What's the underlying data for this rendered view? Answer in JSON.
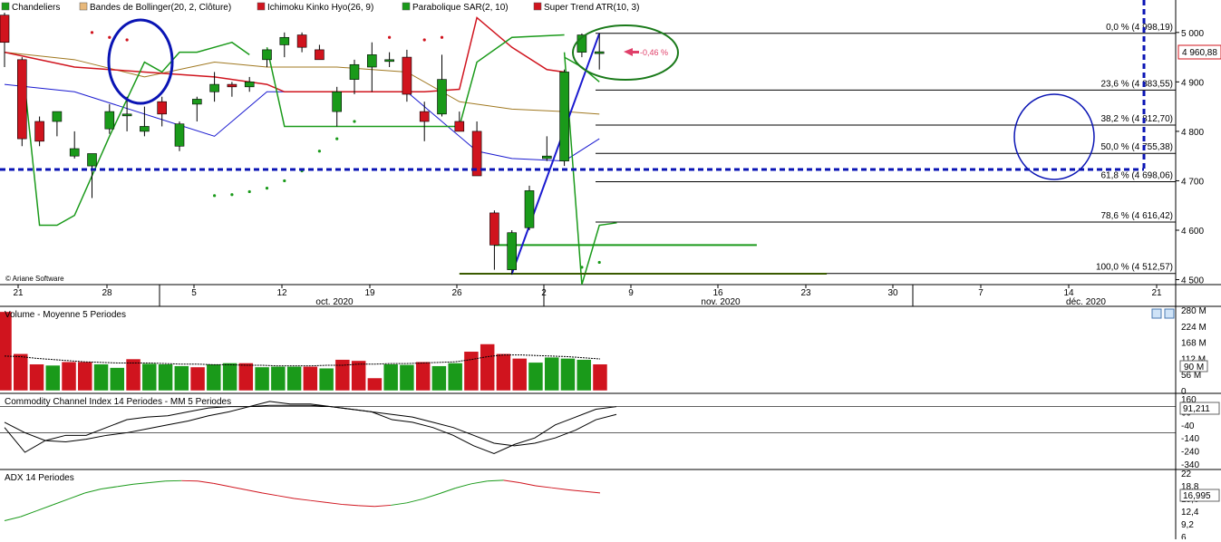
{
  "legend": [
    {
      "label": "Chandeliers",
      "color": "#1a9a1a"
    },
    {
      "label": "Bandes de Bollinger(20, 2, Clôture)",
      "color": "#e8b87a"
    },
    {
      "label": "Ichimoku Kinko Hyo(26, 9)",
      "color": "#d0141e"
    },
    {
      "label": "Parabolique SAR(2, 10)",
      "color": "#1a9a1a"
    },
    {
      "label": "Super Trend ATR(10, 3)",
      "color": "#d0141e"
    }
  ],
  "copyright": "© Ariane Software",
  "badges": {
    "price": "4 960,88",
    "change": "-0,46 %",
    "volume": "90 M",
    "cci": "91,211",
    "adx": "16,995"
  },
  "panels": {
    "volume": "Volume - Moyenne 5 Periodes",
    "cci": "Commodity Channel Index 14 Periodes - MM 5 Periodes",
    "adx": "ADX 14 Periodes"
  },
  "colors": {
    "up": "#1a9a1a",
    "down": "#d0141e",
    "kumo_bear": "#e8b4c8",
    "kumo_bull": "#b8dcb8",
    "bollinger_fill": "#fdf5e6",
    "zone": "#e6e6fa"
  },
  "chart_data": [
    {
      "type": "candlestick",
      "title": "",
      "x_ticks": [
        "21",
        "28",
        "5",
        "12",
        "19",
        "26",
        "2",
        "9",
        "16",
        "23",
        "30",
        "7",
        "14",
        "21"
      ],
      "month_labels": [
        "oct. 2020",
        "nov. 2020",
        "déc. 2020"
      ],
      "ylim": [
        4490,
        5040
      ],
      "y_ticks": [
        "5 000",
        "4 900",
        "4 800",
        "4 700",
        "4 600",
        "4 500"
      ],
      "fibonacci": [
        {
          "label": "0,0 % (4 998,19)",
          "value": 4998.19
        },
        {
          "label": "23,6 % (4 883,55)",
          "value": 4883.55
        },
        {
          "label": "38,2 % (4 812,70)",
          "value": 4812.7
        },
        {
          "label": "50,0 % (4 755,38)",
          "value": 4755.38
        },
        {
          "label": "61,8 % (4 698,06)",
          "value": 4698.06
        },
        {
          "label": "78,6 % (4 616,42)",
          "value": 4616.42
        },
        {
          "label": "100,0 % (4 512,57)",
          "value": 4512.57
        }
      ],
      "last_price": 4960.88,
      "change_pct": -0.46,
      "candles": [
        {
          "o": 5035,
          "h": 5040,
          "l": 4930,
          "c": 4980
        },
        {
          "o": 4945,
          "h": 4950,
          "l": 4770,
          "c": 4785
        },
        {
          "o": 4820,
          "h": 4830,
          "l": 4770,
          "c": 4780
        },
        {
          "o": 4820,
          "h": 4840,
          "l": 4790,
          "c": 4840
        },
        {
          "o": 4750,
          "h": 4800,
          "l": 4745,
          "c": 4765
        },
        {
          "o": 4730,
          "h": 4750,
          "l": 4665,
          "c": 4755
        },
        {
          "o": 4805,
          "h": 4855,
          "l": 4795,
          "c": 4840
        },
        {
          "o": 4835,
          "h": 4870,
          "l": 4800,
          "c": 4835
        },
        {
          "o": 4800,
          "h": 4850,
          "l": 4790,
          "c": 4810
        },
        {
          "o": 4860,
          "h": 4870,
          "l": 4810,
          "c": 4835
        },
        {
          "o": 4770,
          "h": 4820,
          "l": 4760,
          "c": 4815
        },
        {
          "o": 4855,
          "h": 4870,
          "l": 4820,
          "c": 4865
        },
        {
          "o": 4880,
          "h": 4920,
          "l": 4860,
          "c": 4895
        },
        {
          "o": 4895,
          "h": 4900,
          "l": 4870,
          "c": 4890
        },
        {
          "o": 4890,
          "h": 4910,
          "l": 4880,
          "c": 4900
        },
        {
          "o": 4945,
          "h": 4965,
          "l": 4930,
          "c": 4965
        },
        {
          "o": 4975,
          "h": 5000,
          "l": 4950,
          "c": 4990
        },
        {
          "o": 4995,
          "h": 5000,
          "l": 4960,
          "c": 4970
        },
        {
          "o": 4965,
          "h": 4975,
          "l": 4945,
          "c": 4945
        },
        {
          "o": 4840,
          "h": 4890,
          "l": 4810,
          "c": 4880
        },
        {
          "o": 4905,
          "h": 4945,
          "l": 4875,
          "c": 4935
        },
        {
          "o": 4930,
          "h": 4980,
          "l": 4880,
          "c": 4955
        },
        {
          "o": 4945,
          "h": 4960,
          "l": 4930,
          "c": 4945
        },
        {
          "o": 4950,
          "h": 4965,
          "l": 4860,
          "c": 4875
        },
        {
          "o": 4840,
          "h": 4860,
          "l": 4780,
          "c": 4820
        },
        {
          "o": 4835,
          "h": 4955,
          "l": 4830,
          "c": 4905
        },
        {
          "o": 4820,
          "h": 4840,
          "l": 4800,
          "c": 4800
        },
        {
          "o": 4800,
          "h": 4820,
          "l": 4720,
          "c": 4710
        },
        {
          "o": 4635,
          "h": 4640,
          "l": 4520,
          "c": 4570
        },
        {
          "o": 4520,
          "h": 4600,
          "l": 4510,
          "c": 4595
        },
        {
          "o": 4605,
          "h": 4690,
          "l": 4600,
          "c": 4680
        },
        {
          "o": 4745,
          "h": 4790,
          "l": 4740,
          "c": 4750
        },
        {
          "o": 4740,
          "h": 4925,
          "l": 4730,
          "c": 4920
        },
        {
          "o": 4960,
          "h": 4998,
          "l": 4950,
          "c": 4995
        },
        {
          "o": 4960,
          "h": 4998,
          "l": 4925,
          "c": 4961
        }
      ]
    },
    {
      "type": "bar",
      "title": "Volume - Moyenne 5 Periodes",
      "ylim": [
        0,
        280
      ],
      "y_ticks": [
        "280 M",
        "224 M",
        "168 M",
        "112 M",
        "56 M",
        "0"
      ],
      "values": [
        274,
        128,
        92,
        88,
        100,
        100,
        92,
        80,
        110,
        94,
        92,
        86,
        82,
        92,
        96,
        96,
        82,
        84,
        84,
        84,
        78,
        108,
        104,
        44,
        92,
        90,
        100,
        86,
        96,
        136,
        162,
        128,
        112,
        98,
        116,
        112,
        108,
        92
      ],
      "down": [
        1,
        1,
        1,
        0,
        1,
        1,
        0,
        0,
        1,
        0,
        0,
        0,
        1,
        0,
        0,
        1,
        0,
        0,
        0,
        1,
        0,
        1,
        1,
        1,
        0,
        0,
        1,
        0,
        0,
        1,
        1,
        1,
        1,
        0,
        0,
        0,
        0,
        1
      ],
      "ma": [
        120,
        118,
        112,
        108,
        104,
        100,
        98,
        96,
        96,
        96,
        94,
        92,
        92,
        90,
        90,
        88,
        88,
        86,
        86,
        86,
        88,
        88,
        92,
        92,
        94,
        94,
        96,
        98,
        100,
        108,
        118,
        124,
        124,
        122,
        120,
        118,
        114,
        110
      ]
    },
    {
      "type": "line",
      "title": "Commodity Channel Index 14 Periodes - MM 5 Periodes",
      "ylim": [
        -340,
        160
      ],
      "y_ticks": [
        "160",
        "60",
        "-40",
        "-140",
        "-240",
        "-340"
      ],
      "series": [
        {
          "values": [
            -60,
            -250,
            -160,
            -120,
            -120,
            -60,
            0,
            20,
            30,
            60,
            90,
            100,
            100,
            140,
            120,
            120,
            100,
            80,
            60,
            0,
            -20,
            -60,
            -120,
            -200,
            -260,
            -190,
            -140,
            -40,
            20,
            80,
            100
          ]
        },
        {
          "values": [
            -20,
            -100,
            -160,
            -170,
            -150,
            -120,
            -100,
            -70,
            -40,
            -10,
            30,
            60,
            100,
            110,
            110,
            110,
            100,
            80,
            60,
            40,
            20,
            -20,
            -60,
            -120,
            -180,
            -200,
            -180,
            -140,
            -80,
            0,
            40
          ]
        }
      ]
    },
    {
      "type": "line",
      "title": "ADX 14 Periodes",
      "ylim": [
        6,
        22
      ],
      "y_ticks": [
        "22",
        "18,8",
        "15,6",
        "12,4",
        "9,2",
        "6"
      ],
      "series": [
        {
          "values": [
            10,
            11,
            12.5,
            14,
            15.5,
            17,
            18,
            18.6,
            19.2,
            19.6,
            20,
            20.1,
            20,
            19.4,
            18.6,
            17.8,
            17,
            16.3,
            15.6,
            15.1,
            14.6,
            14.1,
            13.8,
            13.6,
            13.9,
            14.5,
            15.5,
            16.8,
            18.2,
            19.3,
            20,
            20.2,
            19.6,
            18.8,
            18.3,
            17.8,
            17.4,
            17
          ]
        },
        {
          "flag": [
            0,
            0,
            0,
            0,
            0,
            0,
            0,
            0,
            0,
            0,
            0,
            1,
            1,
            1,
            1,
            1,
            1,
            1,
            1,
            1,
            1,
            1,
            1,
            1,
            0,
            0,
            0,
            0,
            0,
            0,
            0,
            1,
            1,
            1,
            1,
            1,
            1,
            1
          ]
        }
      ]
    }
  ]
}
